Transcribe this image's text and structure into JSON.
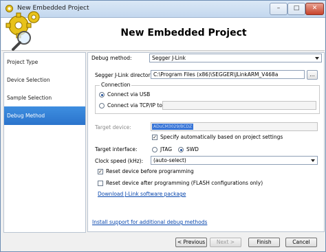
{
  "window": {
    "title": "New Embedded Project",
    "minimize": "–",
    "maximize": "□",
    "close": "✕"
  },
  "header": {
    "title": "New Embedded Project"
  },
  "sidebar": {
    "items": [
      {
        "label": "Project Type"
      },
      {
        "label": "Device Selection"
      },
      {
        "label": "Sample Selection"
      },
      {
        "label": "Debug Method"
      }
    ],
    "active_index": 3
  },
  "debug": {
    "method_label": "Debug method:",
    "method_value": "Segger J-Link",
    "dir_label": "Segger J-Link directory:",
    "dir_value": "C:\\Program Files (x86)\\SEGGER\\JLinkARM_V468a",
    "browse_label": "...",
    "connection_title": "Connection",
    "usb_label": "Connect via USB",
    "tcp_label": "Connect via TCP/IP to:",
    "target_label": "Target device:",
    "target_value": "ADuCM3029/BCDZ",
    "auto_label": "Specify automatically based on project settings",
    "interface_label": "Target interface:",
    "jtag_label": "JTAG",
    "swd_label": "SWD",
    "clock_label": "Clock speed (kHz):",
    "clock_value": "(auto-select)",
    "reset_before_label": "Reset device before programming",
    "reset_after_label": "Reset device after programming (FLASH configurations only)",
    "download_link": "Download J-Link software package",
    "install_link": "Install support for additional debug methods"
  },
  "state": {
    "connection": "usb",
    "auto_specify": true,
    "interface": "swd",
    "reset_before": true,
    "reset_after": false
  },
  "footer": {
    "previous": "< Previous",
    "next": "Next >",
    "finish": "Finish",
    "cancel": "Cancel"
  },
  "colors": {
    "accent": "#2b74cc",
    "link": "#0645ad",
    "selection": "#3875d7"
  },
  "icons": {
    "app": "gear-icon",
    "logo": "gear-magnifier-icon"
  }
}
